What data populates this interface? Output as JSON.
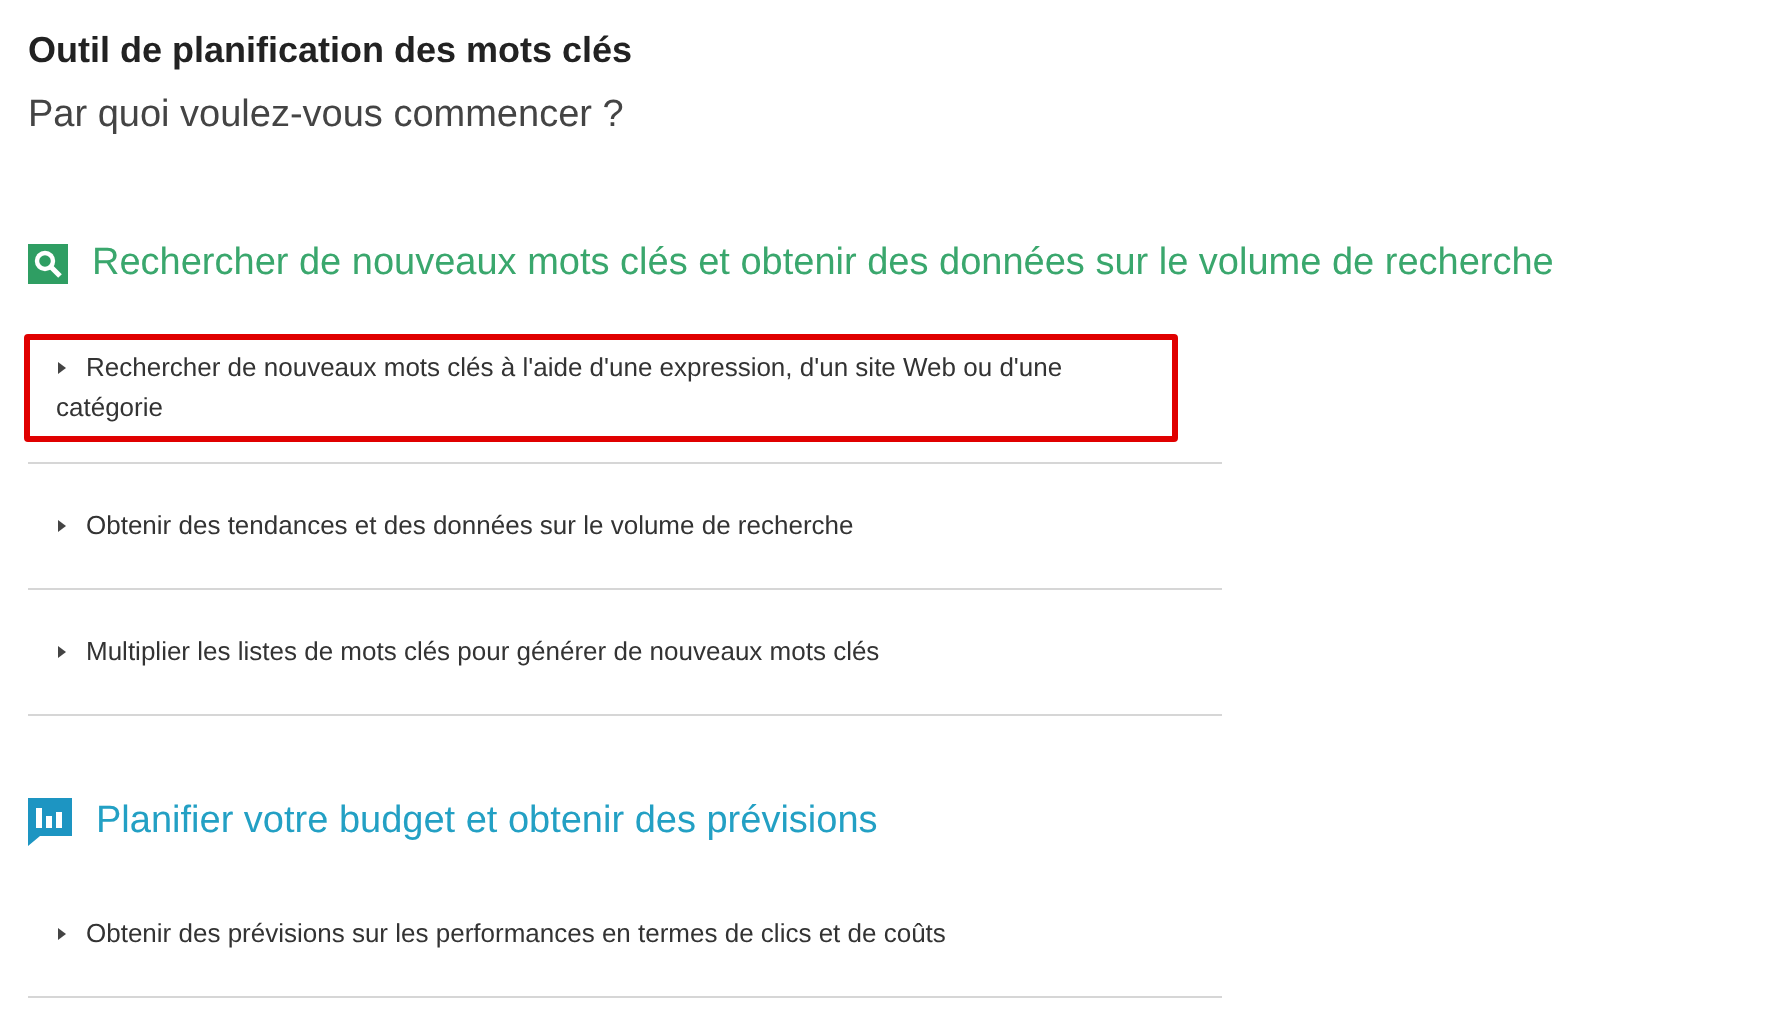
{
  "title": "Outil de planification des mots clés",
  "subtitle": "Par quoi voulez-vous commencer ?",
  "sections": [
    {
      "kind": "search",
      "heading": "Rechercher de nouveaux mots clés et obtenir des données sur le volume de recherche",
      "items": [
        {
          "label": "Rechercher de nouveaux mots clés à l'aide d'une expression, d'un site Web ou d'une catégorie",
          "expanded": false,
          "highlighted": true
        },
        {
          "label": "Obtenir des tendances et des données sur le volume de recherche",
          "expanded": false,
          "highlighted": false
        },
        {
          "label": "Multiplier les listes de mots clés pour générer de nouveaux mots clés",
          "expanded": false,
          "highlighted": false
        }
      ]
    },
    {
      "kind": "budget",
      "heading": "Planifier votre budget et obtenir des prévisions",
      "items": [
        {
          "label": "Obtenir des prévisions sur les performances en termes de clics et de coûts",
          "expanded": false,
          "highlighted": false
        }
      ]
    }
  ]
}
